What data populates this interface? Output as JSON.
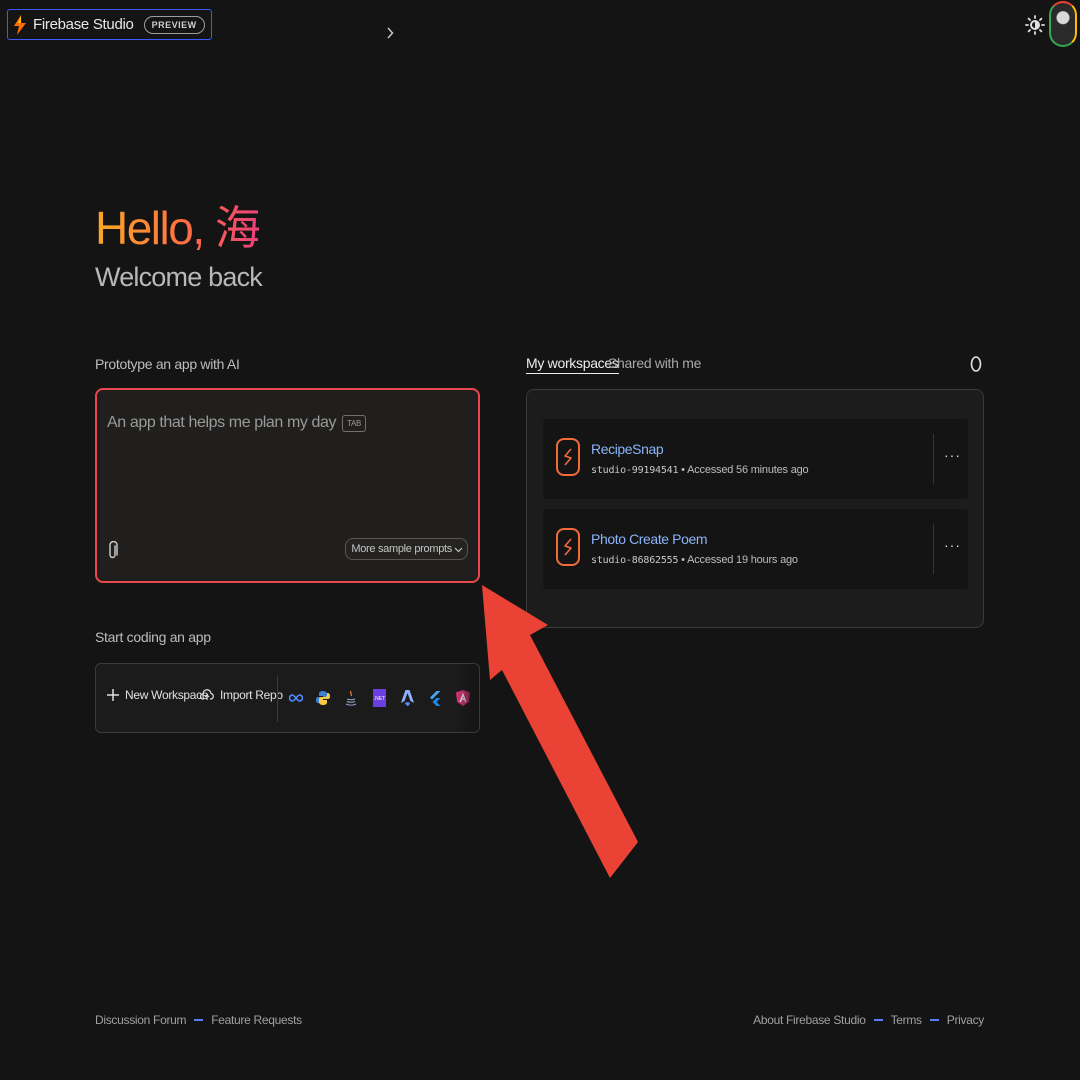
{
  "header": {
    "brand_name": "Firebase Studio",
    "preview_badge": "PREVIEW",
    "theme_icon": "sun-icon",
    "avatar_icon": "user-avatar"
  },
  "greeting": {
    "hello": "Hello, 海",
    "welcome": "Welcome back"
  },
  "prototype": {
    "label": "Prototype an app with AI",
    "placeholder": "An app that helps me plan my day",
    "tab_hint": "TAB",
    "attach_icon": "paperclip-icon",
    "more_prompts": "More sample prompts"
  },
  "coding": {
    "label": "Start coding an app",
    "new_workspace": "New Workspace",
    "import_repo": "Import Repo",
    "templates": [
      {
        "icon": "infinity-icon",
        "color": "#4f8cff"
      },
      {
        "icon": "python-icon",
        "color": "#f7c948"
      },
      {
        "icon": "java-icon",
        "color": "#e07b39"
      },
      {
        "icon": "dotnet-icon",
        "color": "#6a3ee0"
      },
      {
        "icon": "astro-icon",
        "color": "#5c8dff"
      },
      {
        "icon": "flutter-icon",
        "color": "#42a5f5"
      },
      {
        "icon": "angular-icon",
        "color": "#e4337a"
      }
    ]
  },
  "workspaces": {
    "tab_mine": "My workspaces",
    "tab_shared": "Shared with me",
    "items": [
      {
        "name": "RecipeSnap",
        "id": "studio-99194541",
        "accessed": "Accessed 56 minutes ago"
      },
      {
        "name": "Photo Create Poem",
        "id": "studio-86862555",
        "accessed": "Accessed 19 hours ago"
      }
    ]
  },
  "footer": {
    "left": [
      "Discussion Forum",
      "Feature Requests"
    ],
    "right": [
      "About Firebase Studio",
      "Terms",
      "Privacy"
    ]
  },
  "colors": {
    "accent_blue": "#8ab4f8",
    "highlight_red": "#e5484d",
    "brand_orange": "#f26b3a"
  }
}
